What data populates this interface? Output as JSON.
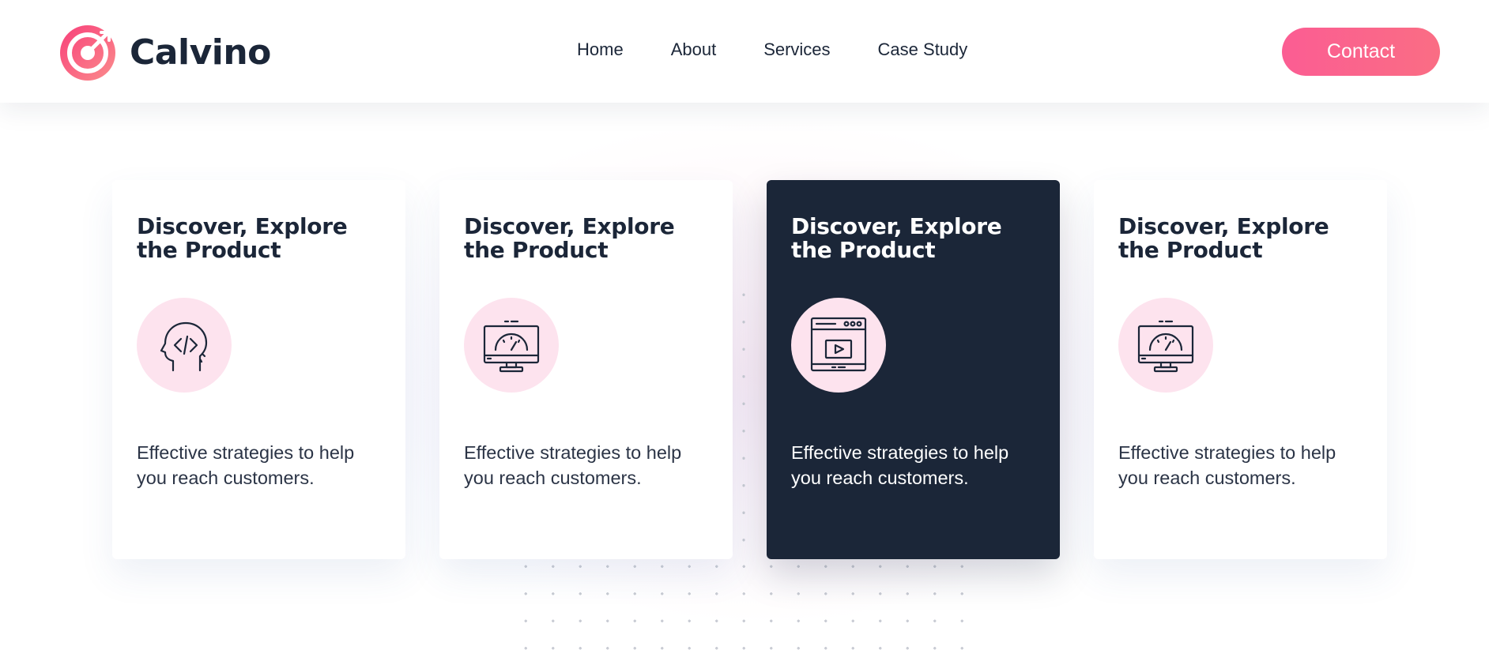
{
  "brand": {
    "name": "Calvino",
    "accent": "#fb5d93",
    "dark": "#1b2638"
  },
  "nav": [
    {
      "label": "Home"
    },
    {
      "label": "About"
    },
    {
      "label": "Services"
    },
    {
      "label": "Case Study"
    }
  ],
  "contact_label": "Contact",
  "cards": [
    {
      "title": "Discover, Explore the Product",
      "icon": "coding-head-icon",
      "description": "Effective strategies to help you reach customers.",
      "active": false
    },
    {
      "title": "Discover, Explore the Product",
      "icon": "dashboard-monitor-icon",
      "description": "Effective strategies to help you reach customers.",
      "active": false
    },
    {
      "title": "Discover, Explore the Product",
      "icon": "video-browser-icon",
      "description": "Effective strategies to help you reach customers.",
      "active": true
    },
    {
      "title": "Discover, Explore the Product",
      "icon": "dashboard-monitor-icon",
      "description": "Effective strategies to help you reach customers.",
      "active": false
    }
  ]
}
